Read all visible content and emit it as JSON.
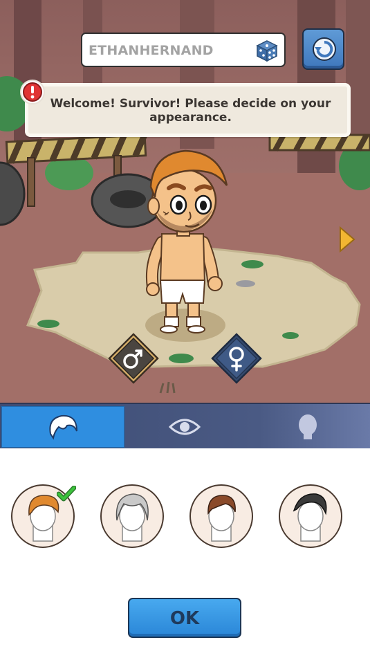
{
  "name_field": {
    "value": "ETHANHERNAND",
    "dice_icon": "dice-icon"
  },
  "refresh_icon": "refresh-icon",
  "notice": {
    "icon": "alert-icon",
    "text": "Welcome! Survivor! Please decide on your appearance."
  },
  "character": {
    "description_icon": "character-avatar"
  },
  "next_arrow_icon": "chevron-right-icon",
  "gender": {
    "male_icon": "male-symbol-icon",
    "female_icon": "female-symbol-icon",
    "selected": "male"
  },
  "tabs": [
    {
      "name": "hair",
      "icon": "hair-icon",
      "active": true
    },
    {
      "name": "eyes",
      "icon": "eye-icon",
      "active": false
    },
    {
      "name": "face",
      "icon": "head-icon",
      "active": false
    }
  ],
  "hair_options": [
    {
      "color": "#e0892f",
      "selected": true
    },
    {
      "color": "#c9c9c9",
      "selected": false
    },
    {
      "color": "#8a4a2a",
      "selected": false
    },
    {
      "color": "#3a3a3a",
      "selected": false
    }
  ],
  "ok_button": {
    "label": "OK"
  },
  "colors": {
    "accent_blue": "#2f8ee0",
    "tab_bar": "#3e4c73",
    "check_green": "#3cc23c"
  }
}
